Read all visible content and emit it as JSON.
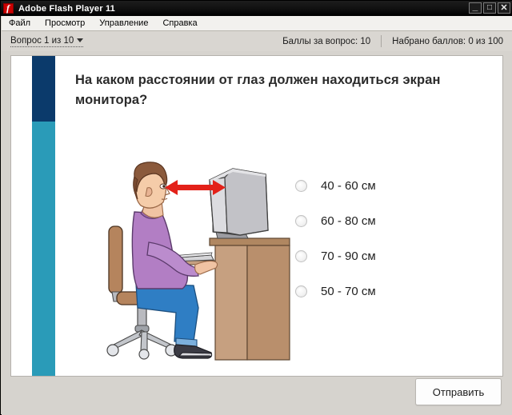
{
  "window": {
    "title": "Adobe Flash Player 11",
    "logo_icon": "flash-logo-icon",
    "buttons": {
      "minimize": "_",
      "maximize": "□",
      "close": "✕"
    }
  },
  "menubar": {
    "items": [
      {
        "label": "Файл"
      },
      {
        "label": "Просмотр"
      },
      {
        "label": "Управление"
      },
      {
        "label": "Справка"
      }
    ]
  },
  "quizbar": {
    "question_nav": "Вопрос 1 из 10",
    "points_for_question": "Баллы за вопрос: 10",
    "points_scored": "Набрано баллов: 0 из 100"
  },
  "quiz": {
    "question": "На каком расстоянии от глаз должен находиться экран монитора?",
    "options": [
      {
        "label": "40 - 60 см",
        "selected": false
      },
      {
        "label": "60 - 80 см",
        "selected": false
      },
      {
        "label": "70 - 90 см",
        "selected": false
      },
      {
        "label": "50 - 70 см",
        "selected": false
      }
    ],
    "submit_label": "Отправить",
    "illustration_alt": "Человек сидит за столом перед монитором, красная стрелка показывает расстояние от глаз до экрана"
  },
  "colors": {
    "accent_dark": "#0b3a6b",
    "accent_teal": "#2a9bb8",
    "arrow_red": "#e32119",
    "sweater_purple": "#b27ec4",
    "jeans_blue": "#2f7ec4",
    "desk_brown": "#c69c76",
    "monitor_gray": "#d8d8da",
    "hair_brown": "#8b5a3c"
  }
}
